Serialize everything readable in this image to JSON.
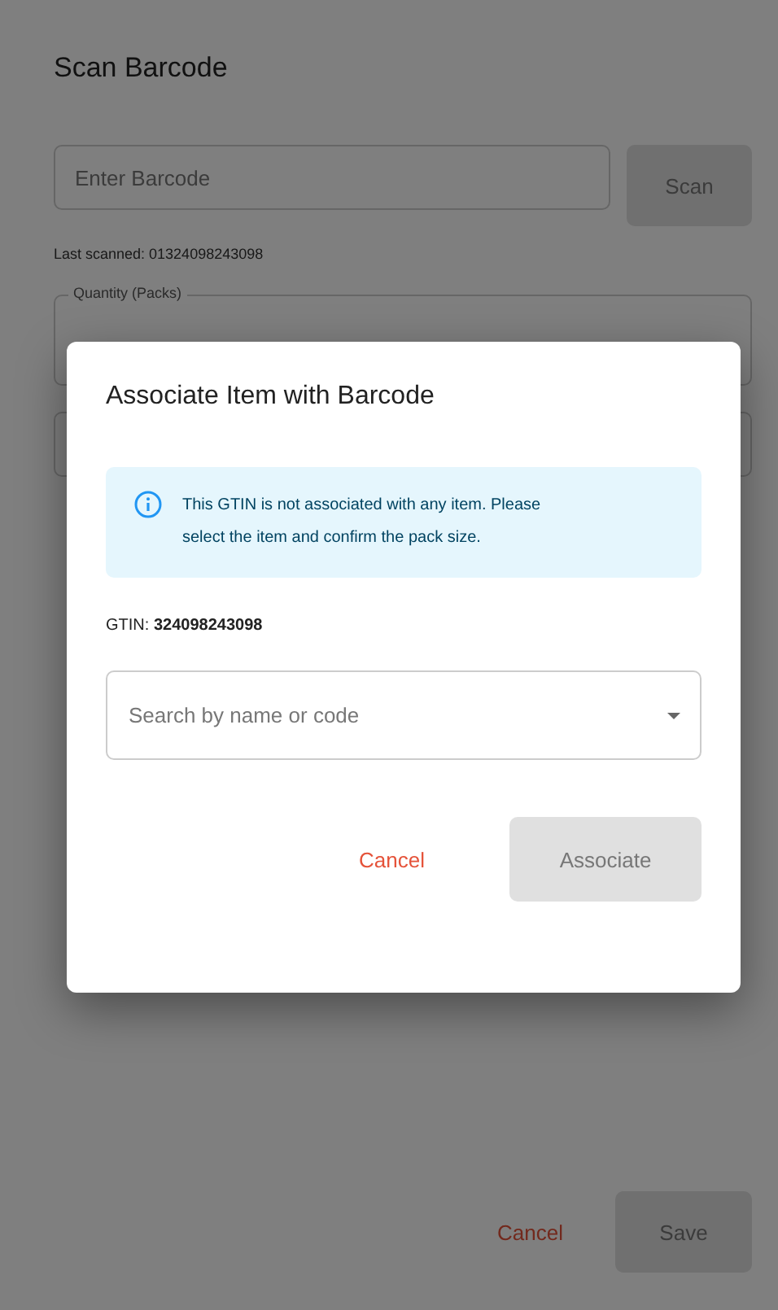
{
  "form": {
    "title": "Scan Barcode",
    "barcode_field": {
      "placeholder": "Enter Barcode"
    },
    "scan_button": {
      "label": "Scan",
      "disabled": true
    },
    "last_scanned": "Last scanned: 01324098243098",
    "quantity_field": {
      "label": "Quantity (Packs)"
    },
    "buttons": [
      {
        "label": "Cancel",
        "kind": "text",
        "disabled": false
      },
      {
        "label": "Save",
        "kind": "contained",
        "disabled": true
      }
    ]
  },
  "dialog": {
    "title": "Associate Item with Barcode",
    "alert": "This GTIN is not associated with any item. Please select the item and confirm the pack size.",
    "gtin": "GTIN: **324098243098**",
    "item_field": {
      "placeholder": "Search by name or code"
    },
    "buttons": [
      {
        "label": "Cancel",
        "kind": "text",
        "disabled": false
      },
      {
        "label": "Associate",
        "kind": "contained",
        "disabled": true
      }
    ]
  }
}
